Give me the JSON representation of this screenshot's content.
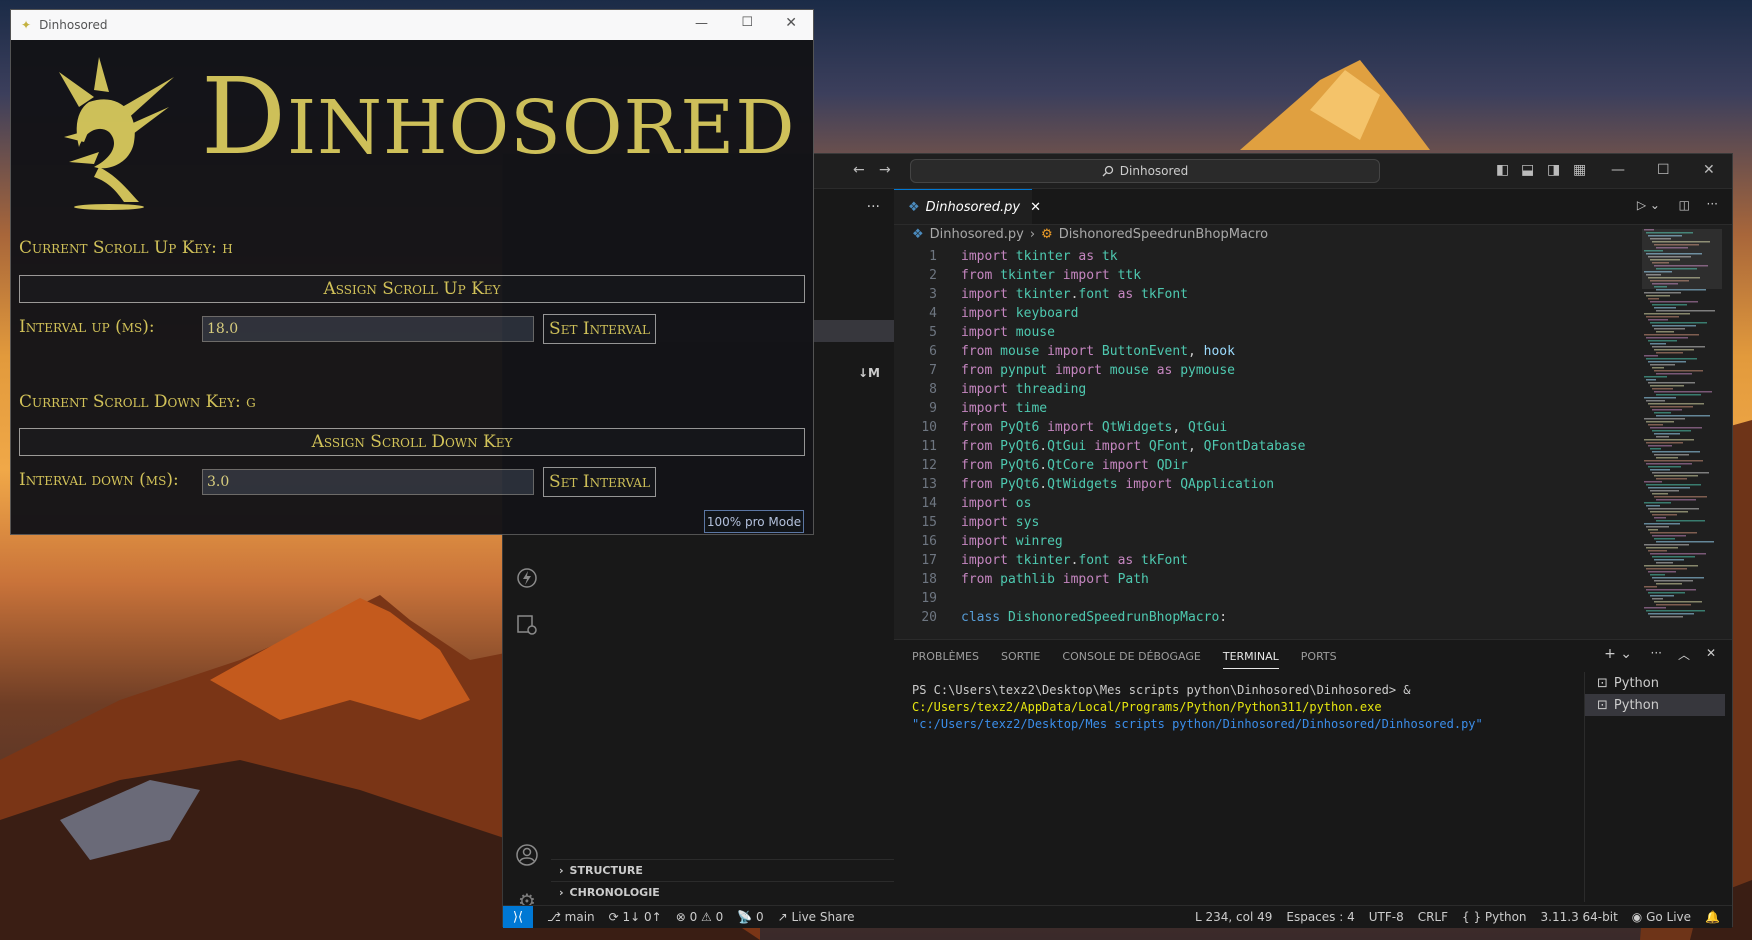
{
  "app": {
    "window_title": "Dinhosored",
    "logo_text": "Dinhosored",
    "scroll_up_label": "Current Scroll Up Key: h",
    "assign_up_label": "Assign Scroll Up Key",
    "interval_up_label": "Interval up (ms):",
    "interval_up_value": "18.0",
    "set_interval_label": "Set Interval",
    "scroll_down_label": "Current Scroll Down Key: g",
    "assign_down_label": "Assign Scroll Down Key",
    "interval_down_label": "Interval down (ms):",
    "interval_down_value": "3.0",
    "pro_mode_label": "100% pro Mode"
  },
  "vscode": {
    "search_text": "Dinhosored",
    "tab_filename": "Dinhosored.py",
    "breadcrumb_file": "Dinhosored.py",
    "breadcrumb_class": "DishonoredSpeedrunBhopMacro",
    "sidebar_badge": "M",
    "sections": [
      "STRUCTURE",
      "CHRONOLOGIE"
    ],
    "code_lines": [
      {
        "n": "1",
        "t": "import tkinter as tk"
      },
      {
        "n": "2",
        "t": "from tkinter import ttk"
      },
      {
        "n": "3",
        "t": "import tkinter.font as tkFont"
      },
      {
        "n": "4",
        "t": "import keyboard"
      },
      {
        "n": "5",
        "t": "import mouse"
      },
      {
        "n": "6",
        "t": "from mouse import ButtonEvent, hook"
      },
      {
        "n": "7",
        "t": "from pynput import mouse as pymouse"
      },
      {
        "n": "8",
        "t": "import threading"
      },
      {
        "n": "9",
        "t": "import time"
      },
      {
        "n": "10",
        "t": "from PyQt6 import QtWidgets, QtGui"
      },
      {
        "n": "11",
        "t": "from PyQt6.QtGui import QFont, QFontDatabase"
      },
      {
        "n": "12",
        "t": "from PyQt6.QtCore import QDir"
      },
      {
        "n": "13",
        "t": "from PyQt6.QtWidgets import QApplication"
      },
      {
        "n": "14",
        "t": "import os"
      },
      {
        "n": "15",
        "t": "import sys"
      },
      {
        "n": "16",
        "t": "import winreg"
      },
      {
        "n": "17",
        "t": "import tkinter.font as tkFont"
      },
      {
        "n": "18",
        "t": "from pathlib import Path"
      },
      {
        "n": "19",
        "t": ""
      },
      {
        "n": "20",
        "t": "class DishonoredSpeedrunBhopMacro:"
      }
    ],
    "panel_tabs": [
      "PROBLÈMES",
      "SORTIE",
      "CONSOLE DE DÉBOGAGE",
      "TERMINAL",
      "PORTS"
    ],
    "terminal_prompt": "PS C:\\Users\\texz2\\Desktop\\Mes scripts python\\Dinhosored\\Dinhosored> & ",
    "terminal_exe": "C:/Users/texz2/AppData/Local/Programs/Python/Python311/python.exe",
    "terminal_arg": "\"c:/Users/texz2/Desktop/Mes scripts python/Dinhosored/Dinhosored/Dinhosored.py\"",
    "terminals": [
      "Python",
      "Python"
    ],
    "status": {
      "branch": "main",
      "sync": "1↓ 0↑",
      "errors": "0",
      "warnings": "0",
      "ports": "0",
      "live_share": "Live Share",
      "position": "L 234, col 49",
      "spaces": "Espaces : 4",
      "encoding": "UTF-8",
      "eol": "CRLF",
      "language": "Python",
      "interpreter": "3.11.3 64-bit",
      "go_live": "Go Live"
    }
  },
  "colors": {
    "gold": "#d2c45a",
    "vscode_bg": "#1f1f1f",
    "accent": "#0078d4"
  }
}
